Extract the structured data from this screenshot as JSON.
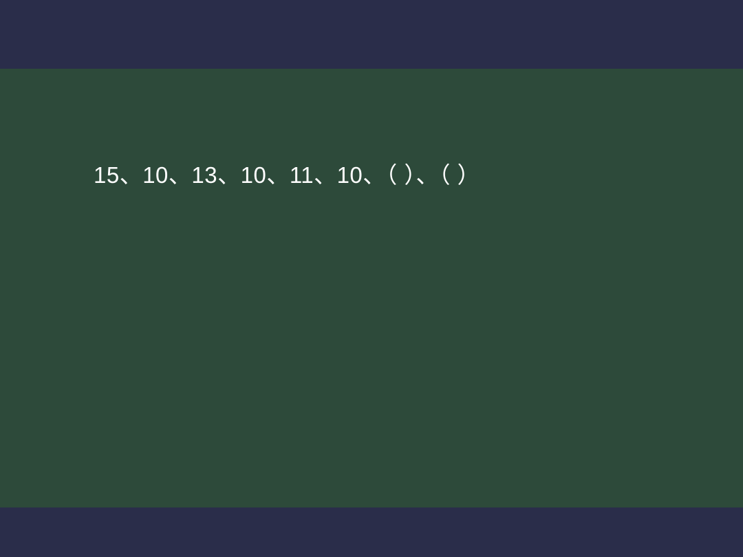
{
  "slide": {
    "sequence_text": "15、10、13、10、11、10、（ ）、（ ）"
  }
}
